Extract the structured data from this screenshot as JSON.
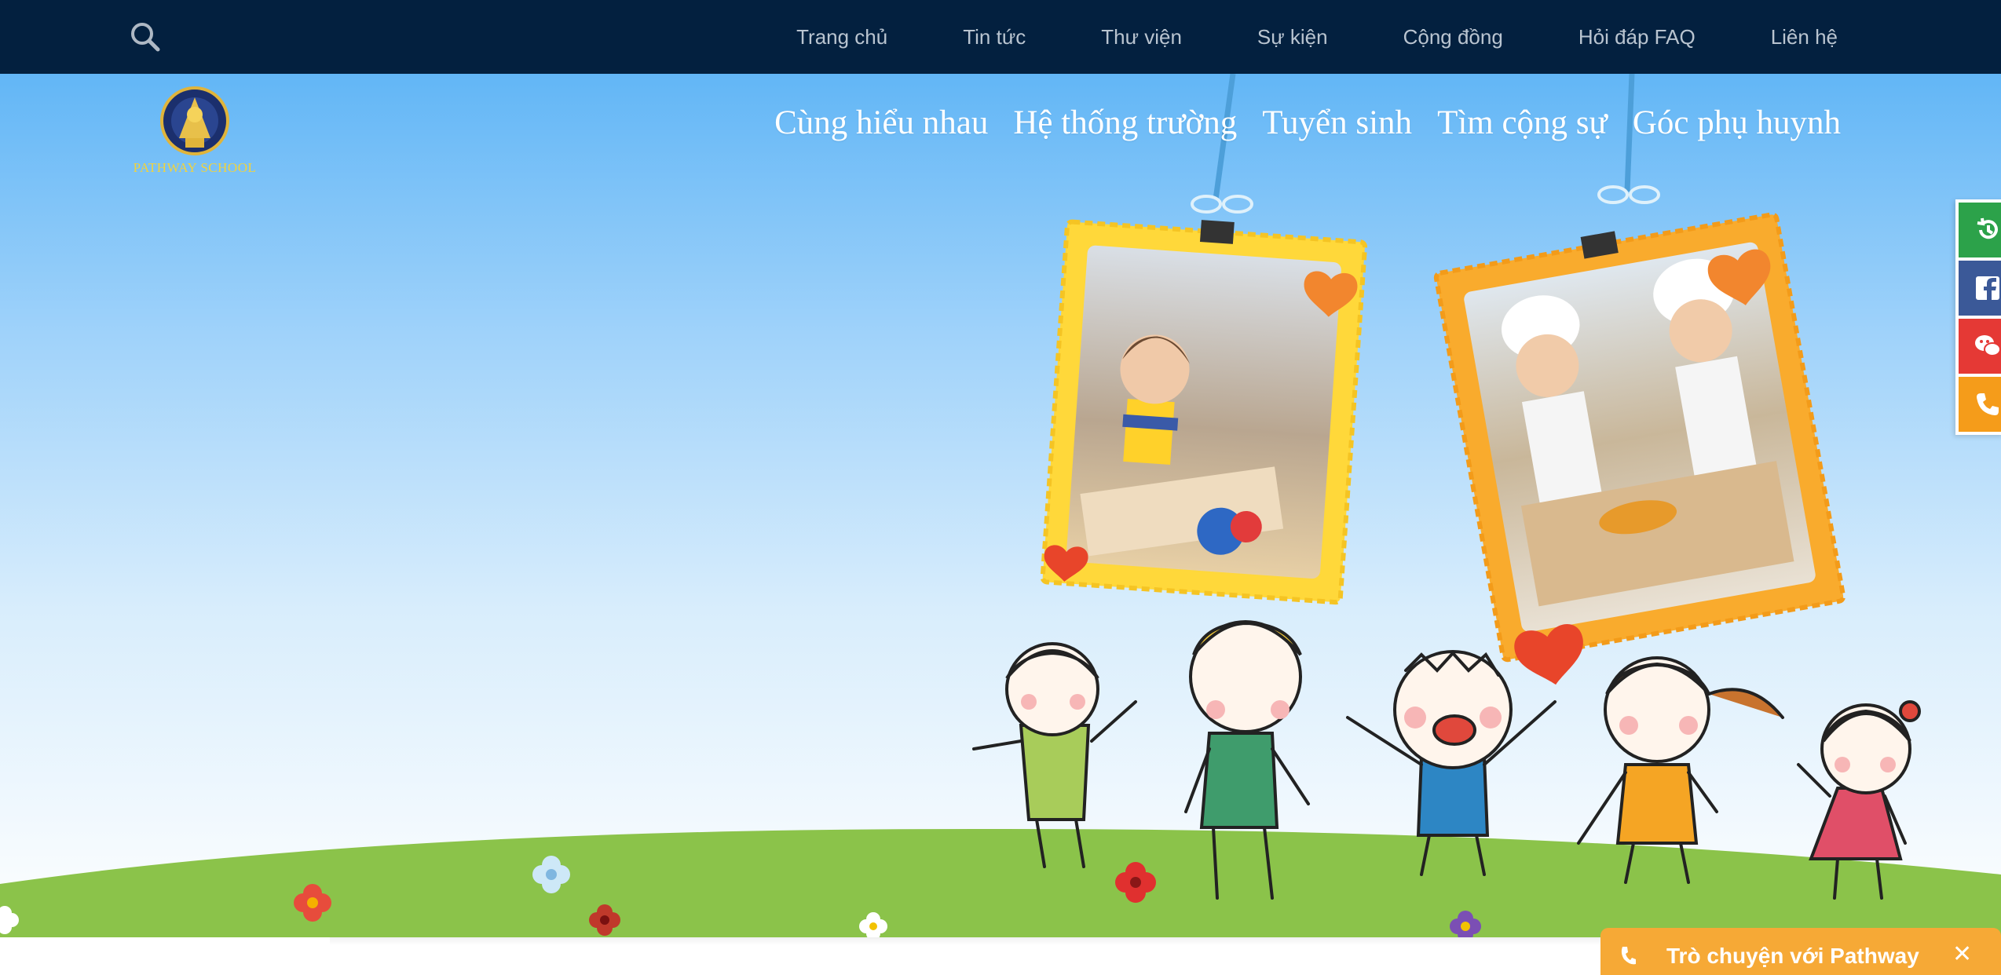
{
  "topbar": {
    "search_icon": "search-icon",
    "nav": [
      "Trang chủ",
      "Tin tức",
      "Thư viện",
      "Sự kiện",
      "Cộng đồng",
      "Hỏi đáp FAQ",
      "Liên hệ"
    ]
  },
  "brand": {
    "logo_text": "PATHWAY SCHOOL"
  },
  "main_nav": [
    "Cùng hiểu nhau",
    "Hệ thống trường",
    "Tuyển sinh",
    "Tìm cộng sự",
    "Góc phụ huynh"
  ],
  "side_buttons": [
    {
      "icon": "history-icon",
      "color": "#2ca24a"
    },
    {
      "icon": "facebook-icon",
      "color": "#3b5998"
    },
    {
      "icon": "wechat-icon",
      "color": "#e53935"
    },
    {
      "icon": "phone-icon",
      "color": "#f59c1a"
    }
  ],
  "chat": {
    "title": "Trò chuyện với Pathway",
    "close": "✕"
  },
  "colors": {
    "topbar": "#03203f",
    "sky": "#62b6f6",
    "grass": "#8bc34a",
    "accent": "#f6a936"
  }
}
